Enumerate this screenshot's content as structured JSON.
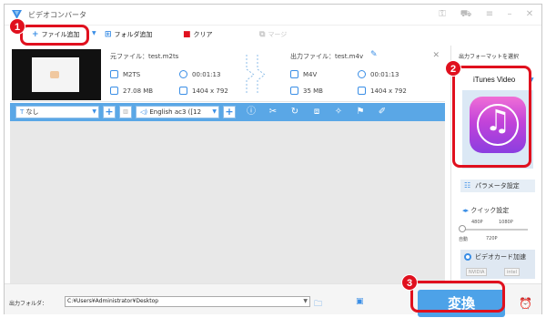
{
  "window": {
    "title": "ビデオコンバータ",
    "controls": {
      "key": "⚿",
      "cart": "⛟",
      "menu": "≡",
      "minimize": "–",
      "close": "✕"
    }
  },
  "toolbar": {
    "add_file": "ファイル追加",
    "add_folder": "フォルダ追加",
    "clear": "クリア",
    "merge": "マージ"
  },
  "file": {
    "source_label": "元ファイル：",
    "source_name": "test.m2ts",
    "source_format": "M2TS",
    "source_duration": "00:01:13",
    "source_size": "27.08 MB",
    "source_resolution": "1404 x 792",
    "output_label": "出力ファイル：",
    "output_name": "test.m4v",
    "output_format": "M4V",
    "output_duration": "00:01:13",
    "output_size": "35 MB",
    "output_resolution": "1404 x 792"
  },
  "editbar": {
    "subtitle_value": "なし",
    "audio_value": "English ac3 ([12",
    "plus": "+"
  },
  "sidepanel": {
    "title": "出力フォーマットを選択",
    "format_name": "iTunes Video",
    "param_button": "パラメータ設定",
    "quick_title": "クイック設定",
    "ticks": {
      "t480": "480P",
      "t1080": "1080P",
      "auto": "自動",
      "t720": "720P"
    },
    "gpu_label": "ビデオカード加速",
    "vendors": [
      "NVIDIA",
      "intel"
    ]
  },
  "bottom": {
    "output_folder_label": "出力フォルダ：",
    "output_path": "C:¥Users¥Administrator¥Desktop",
    "convert_label": "変換"
  },
  "callouts": [
    "1",
    "2",
    "3"
  ],
  "colors": {
    "accent": "#4da2e8",
    "callout": "#e0101e",
    "editbar": "#5aa7e6"
  }
}
